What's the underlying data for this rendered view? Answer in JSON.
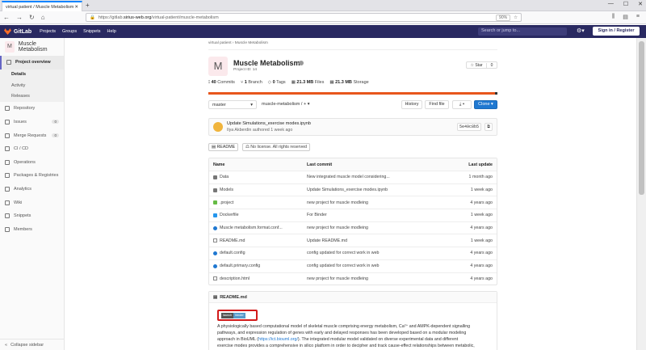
{
  "browser": {
    "tab_title": "virtual patient / Muscle Metabolism",
    "url_prefix": "https://gitlab.",
    "url_domain": "sirius-web.org",
    "url_path": "/virtual-patient/muscle-metabolism",
    "zoom": "90%"
  },
  "gitlab": {
    "brand": "GitLab",
    "nav": [
      "Projects",
      "Groups",
      "Snippets",
      "Help"
    ],
    "search_placeholder": "Search or jump to...",
    "sign_in": "Sign in / Register"
  },
  "sidebar": {
    "project_initial": "M",
    "project_name": "Muscle Metabolism",
    "overview": "Project overview",
    "sub_items": [
      "Details",
      "Activity",
      "Releases"
    ],
    "items": [
      {
        "label": "Repository",
        "icon": "repository-icon"
      },
      {
        "label": "Issues",
        "icon": "issues-icon",
        "badge": "0"
      },
      {
        "label": "Merge Requests",
        "icon": "merge-request-icon",
        "badge": "0"
      },
      {
        "label": "CI / CD",
        "icon": "rocket-icon"
      },
      {
        "label": "Operations",
        "icon": "cloud-icon"
      },
      {
        "label": "Packages & Registries",
        "icon": "package-icon"
      },
      {
        "label": "Analytics",
        "icon": "chart-icon"
      },
      {
        "label": "Wiki",
        "icon": "book-icon"
      },
      {
        "label": "Snippets",
        "icon": "snippet-icon"
      },
      {
        "label": "Members",
        "icon": "users-icon"
      }
    ],
    "collapse": "Collapse sidebar"
  },
  "project": {
    "breadcrumb": [
      "virtual patient",
      "Muscle Metabolism"
    ],
    "initial": "M",
    "title": "Muscle Metabolism",
    "project_id": "Project ID: 14",
    "star_label": "Star",
    "star_count": "0",
    "stats": {
      "commits": "40",
      "commits_label": "Commits",
      "branches": "1",
      "branches_label": "Branch",
      "tags": "0",
      "tags_label": "Tags",
      "files": "21.3 MB",
      "files_label": "Files",
      "storage": "21.3 MB",
      "storage_label": "Storage"
    },
    "branch": "master",
    "path": "muscle-metabolism",
    "buttons": {
      "history": "History",
      "find_file": "Find file",
      "clone": "Clone"
    }
  },
  "commit": {
    "title": "Update Simulations_exercise modes.ipynb",
    "author": "Ilya Akberdin",
    "when": "authored 1 week ago",
    "sha": "5e49c8b5"
  },
  "badges": {
    "readme": "README",
    "license": "No license. All rights reserved"
  },
  "table": {
    "headers": [
      "Name",
      "Last commit",
      "Last update"
    ],
    "rows": [
      {
        "name": "Data",
        "icon": "folder-icon",
        "cls": "folder",
        "commit": "New integrated muscle model considering...",
        "update": "1 month ago"
      },
      {
        "name": "Models",
        "icon": "folder-icon",
        "cls": "folder",
        "commit": "Update Simulations_exercise modes.ipynb",
        "update": "1 week ago"
      },
      {
        "name": ".project",
        "icon": "project-file-icon",
        "cls": "proj",
        "commit": "new project for muscle modleing",
        "update": "4 years ago"
      },
      {
        "name": "Dockerfile",
        "icon": "docker-icon",
        "cls": "dock",
        "commit": "For Binder",
        "update": "1 week ago"
      },
      {
        "name": "Muscle metabolism.format.conf...",
        "icon": "config-file-icon",
        "cls": "dot",
        "commit": "new project for muscle modleing",
        "update": "4 years ago"
      },
      {
        "name": "README.md",
        "icon": "markdown-icon",
        "cls": "file",
        "commit": "Update README.md",
        "update": "1 week ago"
      },
      {
        "name": "default.config",
        "icon": "config-file-icon",
        "cls": "dot",
        "commit": "config updated for correct work in web",
        "update": "4 years ago"
      },
      {
        "name": "default.primary.config",
        "icon": "config-file-icon",
        "cls": "dot",
        "commit": "config updated for correct work in web",
        "update": "4 years ago"
      },
      {
        "name": "description.html",
        "icon": "html-file-icon",
        "cls": "file",
        "commit": "new project for muscle modleing",
        "update": "4 years ago"
      }
    ]
  },
  "readme": {
    "title": "README.md",
    "binder_left": "launch",
    "binder_right": "binder",
    "line1": "A physiologically based computational model of skeletal muscle comprising energy metabolism, Ca²⁺ and AMPK-dependent signalling",
    "line2": "pathways, and expression regulation of genes with early and delayed responses has been developed based on a modular modeling",
    "line3a": "approach in BioUML (",
    "line3link": "https://ict.biouml.org/",
    "line3b": "). The integrated modular model validated on diverse experimental data and different",
    "line4": "exercise modes provides a comprehensive in silico platform in order to decipher and track cause-effect relationships between metabolic,"
  }
}
